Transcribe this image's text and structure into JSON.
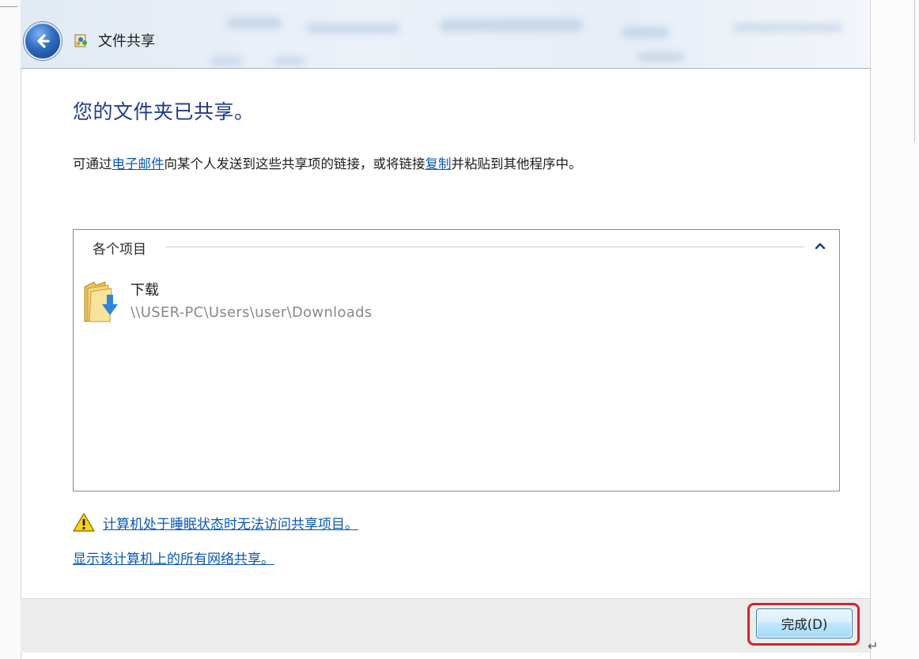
{
  "window": {
    "title": "文件共享"
  },
  "content": {
    "heading": "您的文件夹已共享。",
    "desc_part1": "可通过",
    "desc_link_email": "电子邮件",
    "desc_part2": "向某个人发送到这些共享项的链接，或将链接",
    "desc_link_copy": "复制",
    "desc_part3": "并粘贴到其他程序中。"
  },
  "items_panel": {
    "group_label": "各个项目",
    "items": [
      {
        "name": "下载",
        "path": "\\\\USER-PC\\Users\\user\\Downloads"
      }
    ]
  },
  "links": {
    "sleep_warning": "计算机处于睡眠状态时无法访问共享项目。",
    "show_all_shares": "显示该计算机上的所有网络共享。"
  },
  "footer": {
    "finish_label": "完成(D)"
  },
  "colors": {
    "heading": "#1e3b8a",
    "link": "#0a58b8",
    "highlight": "#d0262c"
  }
}
